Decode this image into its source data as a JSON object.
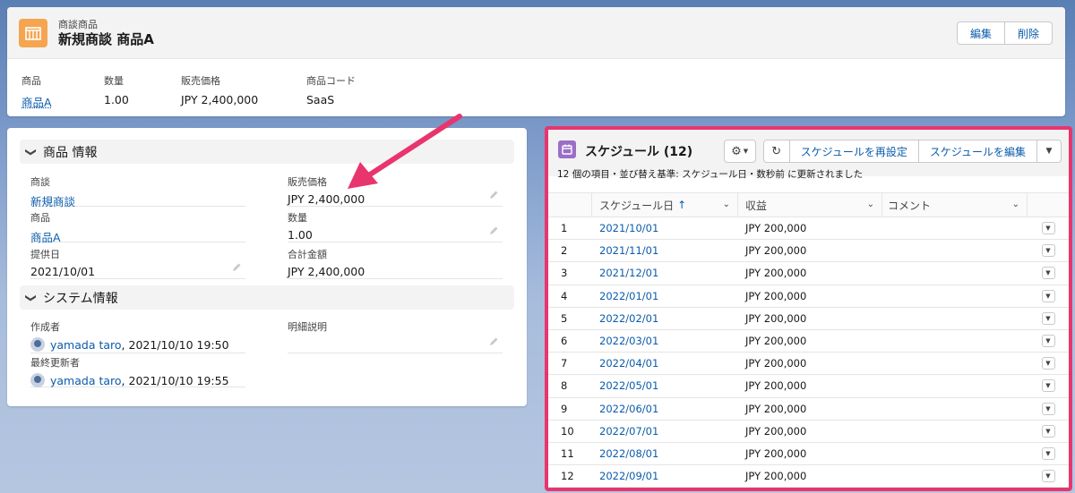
{
  "header": {
    "object_label": "商談商品",
    "title": "新規商談 商品A",
    "buttons": {
      "edit": "編集",
      "delete": "削除"
    },
    "highlights": [
      {
        "label": "商品",
        "value": "商品A",
        "link": true
      },
      {
        "label": "数量",
        "value": "1.00",
        "link": false
      },
      {
        "label": "販売価格",
        "value": "JPY 2,400,000",
        "link": false
      },
      {
        "label": "商品コード",
        "value": "SaaS",
        "link": false
      }
    ]
  },
  "details": {
    "section1_title": "商品 情報",
    "fields": {
      "opportunity": {
        "label": "商談",
        "value": "新規商談"
      },
      "sales_price": {
        "label": "販売価格",
        "value": "JPY 2,400,000"
      },
      "product": {
        "label": "商品",
        "value": "商品A"
      },
      "quantity": {
        "label": "数量",
        "value": "1.00"
      },
      "date": {
        "label": "提供日",
        "value": "2021/10/01"
      },
      "total": {
        "label": "合計金額",
        "value": "JPY 2,400,000"
      }
    },
    "section2_title": "システム情報",
    "system": {
      "created_label": "作成者",
      "created_user": "yamada taro",
      "created_time": ", 2021/10/10 19:50",
      "modified_label": "最終更新者",
      "modified_user": "yamada taro",
      "modified_time": ", 2021/10/10 19:55",
      "description_label": "明細説明"
    }
  },
  "schedule": {
    "title": "スケジュール (12)",
    "subtitle": "12 個の項目・並び替え基準: スケジュール日・数秒前 に更新されました",
    "buttons": {
      "reset": "スケジュールを再設定",
      "edit": "スケジュールを編集"
    },
    "columns": {
      "date": "スケジュール日",
      "revenue": "収益",
      "comment": "コメント"
    },
    "rows": [
      {
        "n": "1",
        "date": "2021/10/01",
        "revenue": "JPY 200,000"
      },
      {
        "n": "2",
        "date": "2021/11/01",
        "revenue": "JPY 200,000"
      },
      {
        "n": "3",
        "date": "2021/12/01",
        "revenue": "JPY 200,000"
      },
      {
        "n": "4",
        "date": "2022/01/01",
        "revenue": "JPY 200,000"
      },
      {
        "n": "5",
        "date": "2022/02/01",
        "revenue": "JPY 200,000"
      },
      {
        "n": "6",
        "date": "2022/03/01",
        "revenue": "JPY 200,000"
      },
      {
        "n": "7",
        "date": "2022/04/01",
        "revenue": "JPY 200,000"
      },
      {
        "n": "8",
        "date": "2022/05/01",
        "revenue": "JPY 200,000"
      },
      {
        "n": "9",
        "date": "2022/06/01",
        "revenue": "JPY 200,000"
      },
      {
        "n": "10",
        "date": "2022/07/01",
        "revenue": "JPY 200,000"
      },
      {
        "n": "11",
        "date": "2022/08/01",
        "revenue": "JPY 200,000"
      },
      {
        "n": "12",
        "date": "2022/09/01",
        "revenue": "JPY 200,000"
      }
    ]
  },
  "colors": {
    "accent": "#e8356e",
    "link": "#0b5cab",
    "object_icon": "#f5a550",
    "schedule_icon": "#9b6ec8"
  }
}
